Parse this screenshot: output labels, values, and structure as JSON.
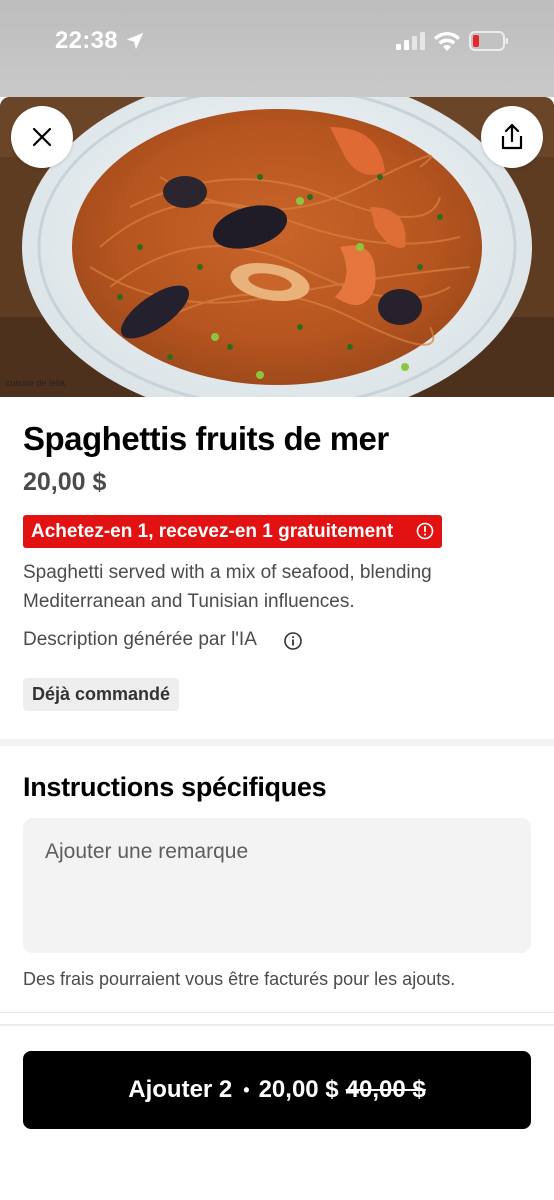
{
  "status_bar": {
    "time": "22:38",
    "icons": [
      "location-arrow-icon",
      "cellular-signal-icon",
      "wifi-icon",
      "battery-low-icon"
    ],
    "battery_color": "#e8262e"
  },
  "hero": {
    "image": "spaghetti-seafood-plate-photo",
    "credit": "cuisine de lella"
  },
  "header_buttons": {
    "close_icon": "close-icon",
    "share_icon": "share-icon"
  },
  "item": {
    "title": "Spaghettis fruits de mer",
    "price": "20,00 $",
    "promo": "Achetez-en 1, recevez-en 1 gratuitement",
    "description": "Spaghetti served with a mix of seafood, blending Mediterranean and Tunisian influences.",
    "ai_note": "Description générée par l'IA",
    "badge": "Déjà commandé"
  },
  "instructions": {
    "title": "Instructions spécifiques",
    "placeholder": "Ajouter une remarque",
    "fee_note": "Des frais pourraient vous être facturés pour les ajouts."
  },
  "cart_button": {
    "label": "Ajouter 2",
    "separator": "•",
    "price": "20,00 $",
    "original_price": "40,00 $"
  },
  "colors": {
    "promo_bg": "#e31212",
    "button_bg": "#000000"
  }
}
